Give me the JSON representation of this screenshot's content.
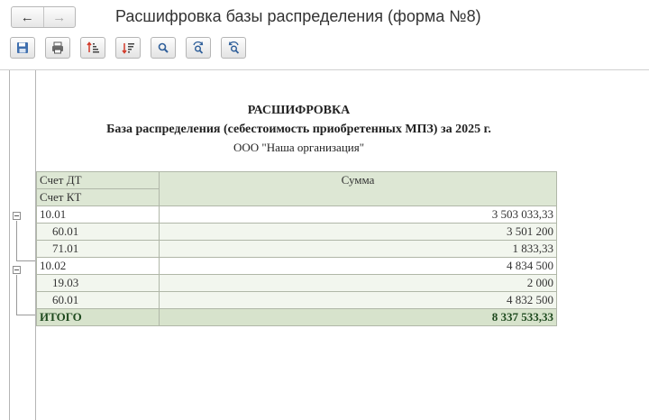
{
  "window": {
    "title": "Расшифровка базы распределения (форма №8)"
  },
  "nav": {
    "back_label": "←",
    "forward_label": "→"
  },
  "toolbar": [
    {
      "name": "save-button",
      "icon": "floppy-disk-icon"
    },
    {
      "name": "print-button",
      "icon": "printer-icon"
    },
    {
      "name": "sort-ascending-button",
      "icon": "sort-ascending-icon"
    },
    {
      "name": "sort-descending-button",
      "icon": "sort-descending-icon"
    },
    {
      "name": "find-button",
      "icon": "search-icon"
    },
    {
      "name": "find-next-button",
      "icon": "search-next-icon"
    },
    {
      "name": "find-previous-button",
      "icon": "search-previous-icon"
    }
  ],
  "report": {
    "title": "РАСШИФРОВКА",
    "subtitle": "База распределения (себестоимость приобретенных МПЗ) за 2025 г.",
    "organization": "ООО \"Наша организация\"",
    "headers": {
      "debit": "Счет ДТ",
      "credit": "Счет КТ",
      "amount": "Сумма"
    },
    "groups": [
      {
        "account": "10.01",
        "amount": "3 503 033,33",
        "rows": [
          {
            "account": "60.01",
            "amount": "3 501 200"
          },
          {
            "account": "71.01",
            "amount": "1 833,33"
          }
        ]
      },
      {
        "account": "10.02",
        "amount": "4 834 500",
        "rows": [
          {
            "account": "19.03",
            "amount": "2 000"
          },
          {
            "account": "60.01",
            "amount": "4 832 500"
          }
        ]
      }
    ],
    "total": {
      "label": "ИТОГО",
      "amount": "8 337 533,33"
    }
  },
  "colors": {
    "header_bg": "#dde7d4",
    "subrow_bg": "#f2f6ee",
    "total_bg": "#d7e3cc",
    "total_text": "#1f4a1f"
  }
}
